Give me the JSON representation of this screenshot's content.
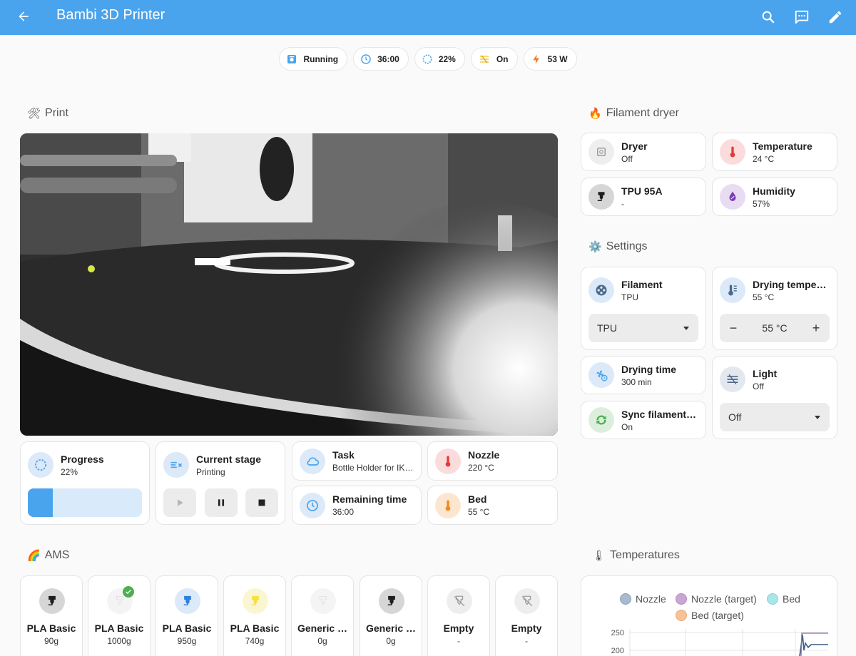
{
  "header": {
    "title": "Bambi 3D Printer"
  },
  "badges": [
    {
      "icon": "printer-icon",
      "label": "Running"
    },
    {
      "icon": "clock-icon",
      "label": "36:00"
    },
    {
      "icon": "progress-icon",
      "label": "22%"
    },
    {
      "icon": "light-icon",
      "label": "On"
    },
    {
      "icon": "lightning-icon",
      "label": "53 W"
    }
  ],
  "print": {
    "title": "Print",
    "progress": {
      "name": "Progress",
      "state": "22%",
      "fraction": 0.22
    },
    "stage": {
      "name": "Current stage",
      "state": "Printing"
    },
    "task": {
      "name": "Task",
      "state": "Bottle Holder for IK…"
    },
    "remaining": {
      "name": "Remaining time",
      "state": "36:00"
    },
    "nozzle": {
      "name": "Nozzle",
      "state": "220 °C"
    },
    "bed": {
      "name": "Bed",
      "state": "55 °C"
    }
  },
  "dryer": {
    "title": "Filament dryer",
    "dryer": {
      "name": "Dryer",
      "state": "Off"
    },
    "temperature": {
      "name": "Temperature",
      "state": "24 °C"
    },
    "filament": {
      "name": "TPU 95A",
      "state": "-"
    },
    "humidity": {
      "name": "Humidity",
      "state": "57%"
    }
  },
  "settings": {
    "title": "Settings",
    "filament": {
      "name": "Filament",
      "state": "TPU",
      "selected": "TPU"
    },
    "drying_temp": {
      "name": "Drying temperat…",
      "state": "55 °C",
      "value": "55 °C"
    },
    "drying_time": {
      "name": "Drying time",
      "state": "300 min"
    },
    "light": {
      "name": "Light",
      "state": "Off",
      "selected": "Off"
    },
    "sync": {
      "name": "Sync filament a…",
      "state": "On"
    }
  },
  "ams": {
    "title": "AMS",
    "slots": [
      {
        "name": "PLA Basic",
        "weight": "90g",
        "color": "#1e1e1e",
        "bg": "#d6d6d6"
      },
      {
        "name": "PLA Basic",
        "weight": "1000g",
        "color": "#f2f2f2",
        "bg": "#f4f4f4",
        "active": true
      },
      {
        "name": "PLA Basic",
        "weight": "950g",
        "color": "#2f7fd8",
        "bg": "#dbe9f8"
      },
      {
        "name": "PLA Basic",
        "weight": "740g",
        "color": "#f5e04a",
        "bg": "#fbf6d2"
      },
      {
        "name": "Generic …",
        "weight": "0g",
        "color": "#f2f2f2",
        "bg": "#f4f4f4"
      },
      {
        "name": "Generic …",
        "weight": "0g",
        "color": "#1e1e1e",
        "bg": "#d6d6d6"
      },
      {
        "name": "Empty",
        "weight": "-",
        "color": "#9e9e9e",
        "bg": "#eeeeee"
      },
      {
        "name": "Empty",
        "weight": "-",
        "color": "#9e9e9e",
        "bg": "#eeeeee"
      }
    ]
  },
  "temperatures": {
    "title": "Temperatures"
  },
  "chart_data": {
    "type": "line",
    "series": [
      {
        "name": "Nozzle",
        "color": "#a9b9cf"
      },
      {
        "name": "Nozzle (target)",
        "color": "#c9a6d4"
      },
      {
        "name": "Bed",
        "color": "#a8e6ea"
      },
      {
        "name": "Bed (target)",
        "color": "#f6c29a"
      }
    ],
    "y_ticks": [
      "250",
      "200"
    ],
    "legend": "top"
  }
}
